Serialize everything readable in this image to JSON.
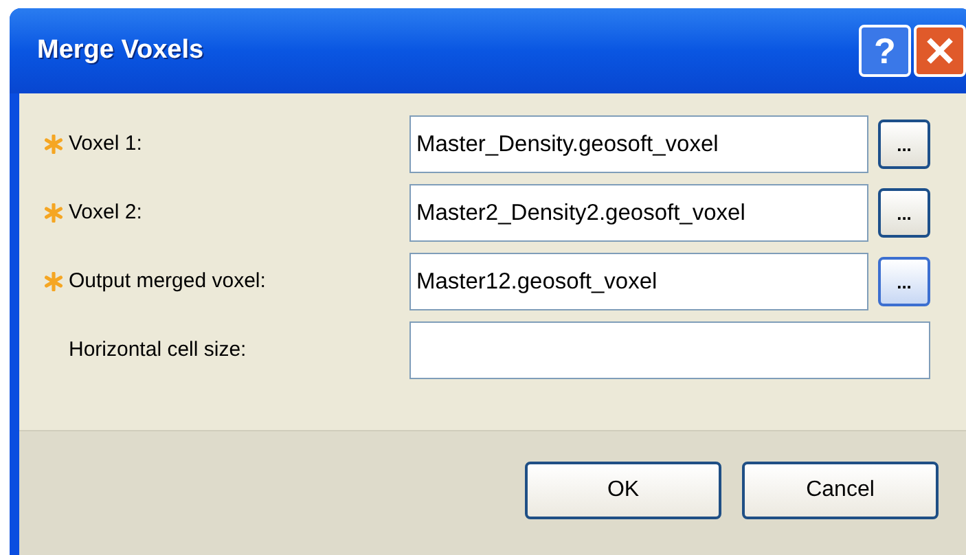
{
  "window": {
    "title": "Merge Voxels",
    "help_button": "?"
  },
  "fields": [
    {
      "label": "Voxel 1:",
      "required": true,
      "value": "Master_Density.geosoft_voxel",
      "browse": {
        "label": "...",
        "highlighted": false
      }
    },
    {
      "label": "Voxel 2:",
      "required": true,
      "value": "Master2_Density2.geosoft_voxel",
      "browse": {
        "label": "...",
        "highlighted": false
      }
    },
    {
      "label": "Output merged voxel:",
      "required": true,
      "value": "Master12.geosoft_voxel",
      "browse": {
        "label": "...",
        "highlighted": true
      }
    },
    {
      "label": "Horizontal cell size:",
      "required": false
    }
  ],
  "buttons": [
    "OK",
    "Cancel"
  ]
}
